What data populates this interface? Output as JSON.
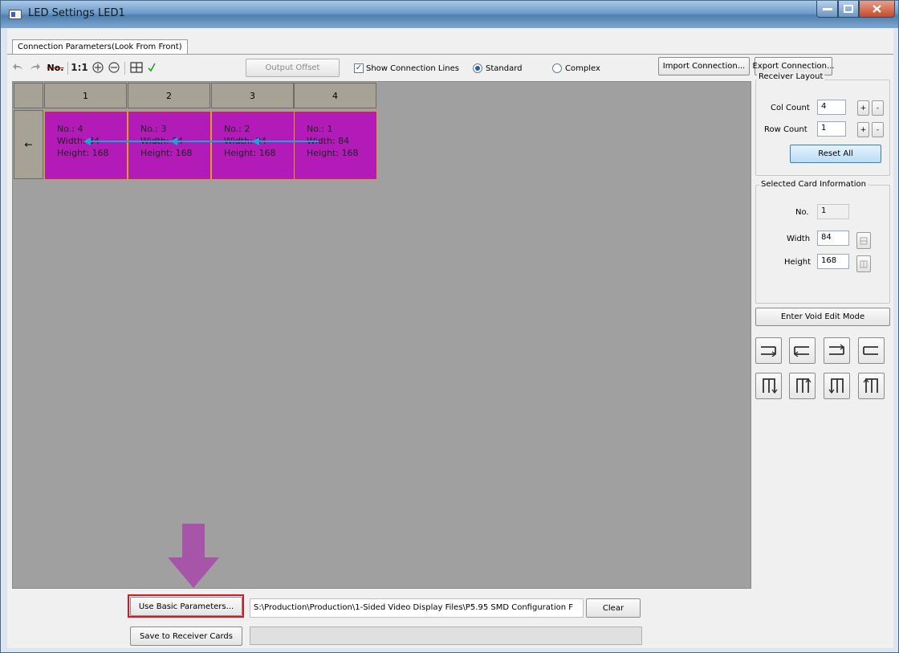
{
  "window": {
    "title": "LED Settings LED1"
  },
  "tab": {
    "label": "Connection Parameters(Look From Front)"
  },
  "toolbar": {
    "ratio_label": "1:1",
    "number_label": "No.",
    "output_offset_label": "Output Offset",
    "show_lines_label": "Show Connection Lines",
    "standard_label": "Standard",
    "complex_label": "Complex",
    "import_label": "Import Connection...",
    "export_label": "Export Connection..."
  },
  "grid": {
    "columns": [
      "1",
      "2",
      "3",
      "4"
    ],
    "row_arrow": "←",
    "cells": [
      {
        "no": "No.: 4",
        "width": "Width: 84",
        "height": "Height: 168"
      },
      {
        "no": "No.: 3",
        "width": "Width: 84",
        "height": "Height: 168"
      },
      {
        "no": "No.: 2",
        "width": "Width: 84",
        "height": "Height: 168"
      },
      {
        "no": "No.: 1",
        "width": "Width: 84",
        "height": "Height: 168"
      }
    ]
  },
  "receiver_layout": {
    "title": "Receiver Layout",
    "col_label": "Col Count",
    "col_value": "4",
    "row_label": "Row Count",
    "row_value": "1",
    "plus": "+",
    "minus": "-",
    "reset_label": "Reset All"
  },
  "selected_card": {
    "title": "Selected Card Information",
    "no_label": "No.",
    "no_value": "1",
    "width_label": "Width",
    "width_value": "84",
    "height_label": "Height",
    "height_value": "168"
  },
  "void_edit_label": "Enter Void Edit Mode",
  "bottom": {
    "use_basic_label": "Use Basic Parameters...",
    "path_value": "S:\\Production\\Production\\1-Sided Video Display Files\\P5.95 SMD Configuration F",
    "clear_label": "Clear",
    "save_label": "Save to Receiver Cards"
  },
  "colors": {
    "cell_fill": "#b21bb8",
    "connection_line": "#18a8d8",
    "highlight_box": "#e0141c",
    "annotation_arrow": "#a64ca8"
  }
}
